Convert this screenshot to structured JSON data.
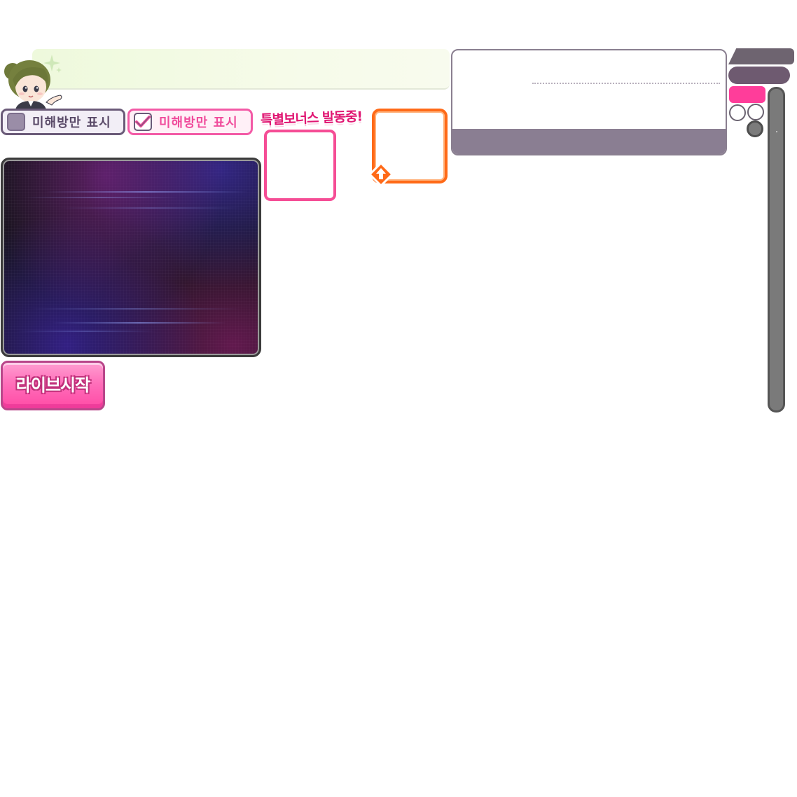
{
  "banner": {
    "message": ""
  },
  "filters": {
    "unplayed_only_off_label": "미해방만 표시",
    "unplayed_only_on_label": "미해방만 표시"
  },
  "bonus": {
    "title": "특별보너스 발동중!"
  },
  "start_button": {
    "label": "라이브시작"
  },
  "colors": {
    "accent_pink": "#ff3d9a",
    "bonus_border": "#f54d95",
    "up_border": "#ff6a18",
    "panel_footer": "#8a7e92"
  },
  "icons": {
    "mascot": "mascot-character",
    "sparkle": "sparkle-icon",
    "check": "checkmark-icon",
    "up_arrow": "up-arrow-icon"
  }
}
